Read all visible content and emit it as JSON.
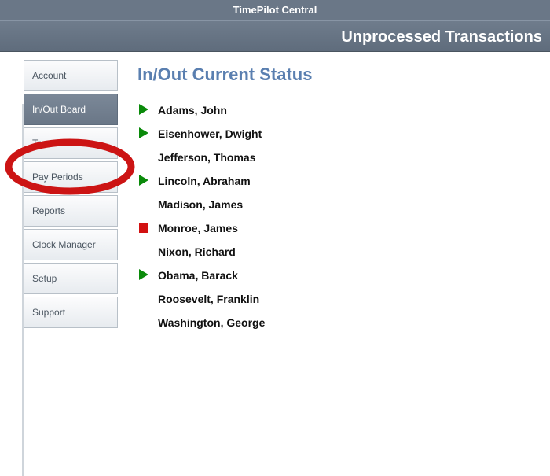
{
  "app": {
    "title": "TimePilot Central",
    "subtitle": "Unprocessed Transactions"
  },
  "sidebar": {
    "items": [
      {
        "label": "Account"
      },
      {
        "label": "In/Out Board",
        "active": true
      },
      {
        "label": "Transactions"
      },
      {
        "label": "Pay Periods"
      },
      {
        "label": "Reports"
      },
      {
        "label": "Clock Manager"
      },
      {
        "label": "Setup"
      },
      {
        "label": "Support"
      }
    ]
  },
  "page": {
    "title": "In/Out Current Status"
  },
  "employees": [
    {
      "name": "Adams, John",
      "status": "in"
    },
    {
      "name": "Eisenhower, Dwight",
      "status": "in"
    },
    {
      "name": "Jefferson, Thomas",
      "status": "none"
    },
    {
      "name": "Lincoln, Abraham",
      "status": "in"
    },
    {
      "name": "Madison, James",
      "status": "none"
    },
    {
      "name": "Monroe, James",
      "status": "out"
    },
    {
      "name": "Nixon, Richard",
      "status": "none"
    },
    {
      "name": "Obama, Barack",
      "status": "in"
    },
    {
      "name": "Roosevelt, Franklin",
      "status": "none"
    },
    {
      "name": "Washington, George",
      "status": "none"
    }
  ]
}
